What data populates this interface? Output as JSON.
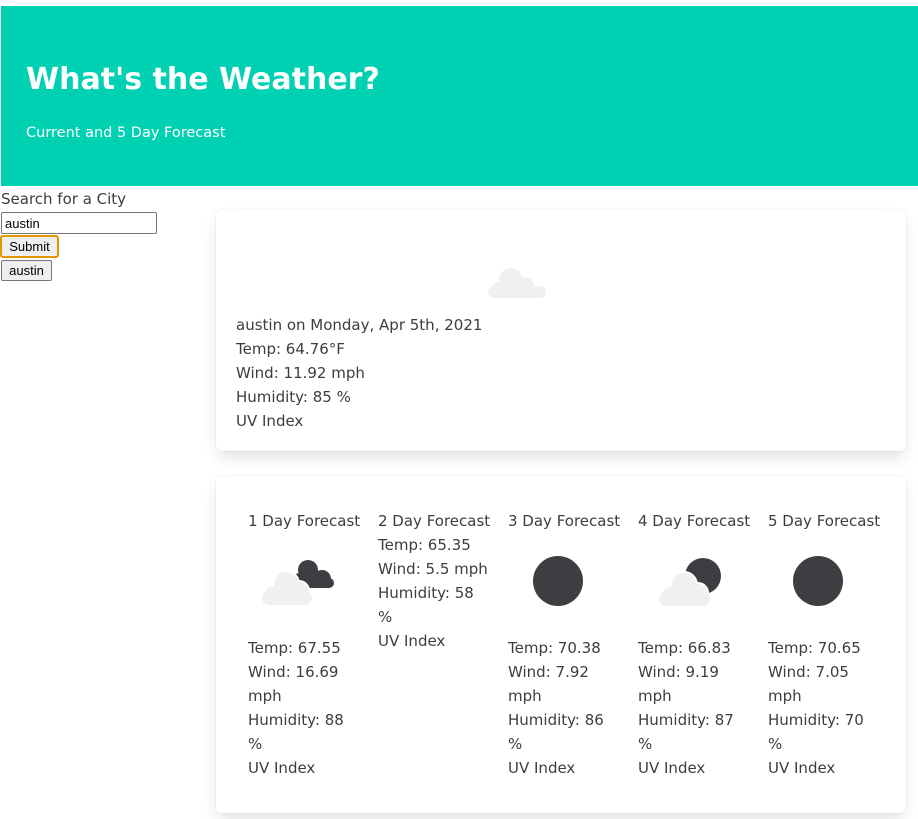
{
  "header": {
    "title": "What's the Weather?",
    "subtitle": "Current and 5 Day Forecast"
  },
  "search": {
    "label": "Search for a City",
    "value": "austin",
    "submit_label": "Submit",
    "history": [
      "austin"
    ]
  },
  "current": {
    "icon": "cloud-icon",
    "city_date": "austin on Monday, Apr 5th, 2021",
    "temp": "Temp: 64.76°F",
    "wind": "Wind: 11.92 mph",
    "humidity": "Humidity: 85 %",
    "uv": "UV Index"
  },
  "forecast": [
    {
      "title": "1 Day Forecast",
      "icon": "cloud-moon-cloud-icon",
      "temp": "Temp: 67.55",
      "wind": "Wind: 16.69 mph",
      "humidity": "Humidity: 88 %",
      "uv": "UV Index"
    },
    {
      "title": "2 Day Forecast",
      "icon": "none",
      "temp": "Temp: 65.35",
      "wind": "Wind: 5.5 mph",
      "humidity": "Humidity: 58 %",
      "uv": "UV Index"
    },
    {
      "title": "3 Day Forecast",
      "icon": "moon-icon",
      "temp": "Temp: 70.38",
      "wind": "Wind: 7.92 mph",
      "humidity": "Humidity: 86 %",
      "uv": "UV Index"
    },
    {
      "title": "4 Day Forecast",
      "icon": "cloud-moon-icon",
      "temp": "Temp: 66.83",
      "wind": "Wind: 9.19 mph",
      "humidity": "Humidity: 87 %",
      "uv": "UV Index"
    },
    {
      "title": "5 Day Forecast",
      "icon": "moon-icon",
      "temp": "Temp: 70.65",
      "wind": "Wind: 7.05 mph",
      "humidity": "Humidity: 70 %",
      "uv": "UV Index"
    }
  ],
  "colors": {
    "hero": "#00d1b2",
    "cloud": "#f0f0ef",
    "moon": "#3e3e42",
    "text": "#3d3d3d"
  }
}
